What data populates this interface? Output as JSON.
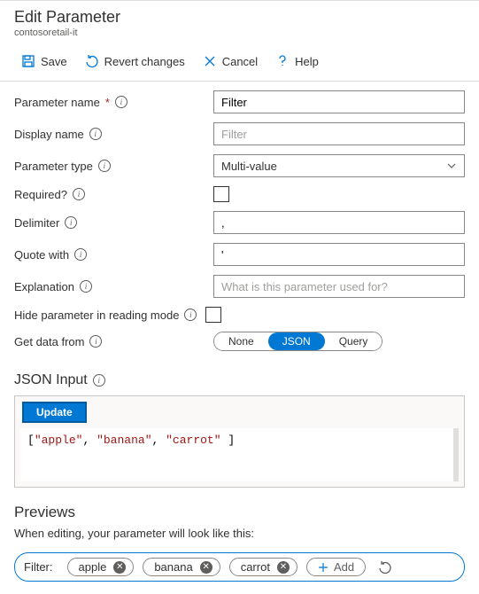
{
  "header": {
    "title": "Edit Parameter",
    "subtitle": "contosoretail-it"
  },
  "toolbar": {
    "save": "Save",
    "revert": "Revert changes",
    "cancel": "Cancel",
    "help": "Help"
  },
  "form": {
    "param_name_label": "Parameter name",
    "param_name_value": "Filter",
    "display_name_label": "Display name",
    "display_name_placeholder": "Filter",
    "param_type_label": "Parameter type",
    "param_type_value": "Multi-value",
    "required_label": "Required?",
    "delimiter_label": "Delimiter",
    "delimiter_value": ",",
    "quote_label": "Quote with",
    "quote_value": "'",
    "explanation_label": "Explanation",
    "explanation_placeholder": "What is this parameter used for?",
    "hide_label": "Hide parameter in reading mode",
    "getdata_label": "Get data from",
    "getdata_options": {
      "none": "None",
      "json": "JSON",
      "query": "Query"
    }
  },
  "json_section": {
    "title": "JSON Input",
    "update_btn": "Update",
    "content_values": [
      "apple",
      "banana",
      "carrot"
    ]
  },
  "previews": {
    "title": "Previews",
    "desc": "When editing, your parameter will look like this:",
    "filter_label": "Filter:",
    "chips": [
      "apple",
      "banana",
      "carrot"
    ],
    "add_label": "Add"
  },
  "colors": {
    "accent": "#0078d4"
  }
}
